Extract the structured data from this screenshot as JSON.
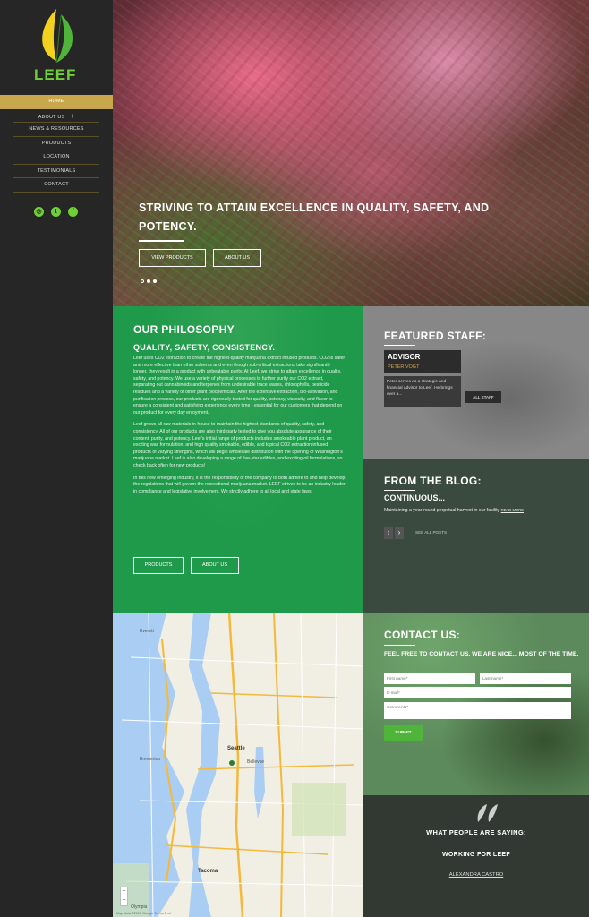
{
  "brand": {
    "name": "LEEF",
    "accent": "#6fcf36",
    "gold": "#c9a84d"
  },
  "nav": {
    "items": [
      {
        "label": "HOME"
      },
      {
        "label": "ABOUT US"
      },
      {
        "label": "NEWS & RESOURCES"
      },
      {
        "label": "PRODUCTS"
      },
      {
        "label": "LOCATION"
      },
      {
        "label": "TESTIMONIALS"
      },
      {
        "label": "CONTACT"
      }
    ],
    "about_expand": "+"
  },
  "social": {
    "instagram": "◎",
    "twitter": "t",
    "facebook": "f"
  },
  "hero": {
    "title": "STRIVING TO ATTAIN EXCELLENCE IN QUALITY, SAFETY, AND POTENCY.",
    "btn_products": "VIEW PRODUCTS",
    "btn_about": "ABOUT US"
  },
  "philosophy": {
    "title": "OUR PHILOSOPHY",
    "subtitle": "QUALITY, SAFETY, CONSISTENCY.",
    "p1": "Leef uses CO2 extraction to create the highest-quality marijuana extract infused products. CO2 is safer and more effective than other solvents and even though sub-critical extractions take significantly longer, they result in a product with unbeatable purity. At Leef, we strive to attain excellence in quality, safety, and potency. We use a variety of physical processes to further purify our CO2 extract, separating out cannabinoids and terpenes from undesirable trace waxes, chlorophylls, pesticide residues and a variety of other plant biochemicals. After the extensive extraction, bio-activation, and purification process, our products are rigorously tested for quality, potency, viscosity, and flavor to ensure a consistent and satisfying experience every time - essential for our customers that depend on our product for every day enjoyment.",
    "p2": "Leef grows all raw materials in-house to maintain the highest standards of quality, safety, and consistency. All of our products are also third-party tested to give you absolute assurance of their content, purity, and potency. Leef's initial range of products includes smokeable plant product, an exciting wax formulation, and high quality smokable, edible, and topical CO2 extraction infused products of varying strengths, which will begin wholesale distribution with the opening of Washington's marijuana market. Leef is also developing a range of five-star edibles, and exciting oil formulations, so check back often for new products!",
    "p3": "In this new emerging industry, it is the responsibility of the company to both adhere to and help develop the regulations that will govern the recreational marijuana market. LEEF strives to be an industry leader in compliance and legislative involvement. We strictly adhere to all local and state laws.",
    "btn_products": "PRODUCTS",
    "btn_about": "ABOUT US"
  },
  "staff": {
    "title": "FEATURED STAFF:",
    "role": "ADVISOR",
    "name": "PETER VOGT",
    "desc": "Peter serves as a strategic and financial advisor to Leef. He brings over a...",
    "btn_all": "ALL STAFF"
  },
  "blog": {
    "title": "FROM THE BLOG:",
    "post_title": "CONTINUOUS...",
    "excerpt": "Maintaining a year-round perpetual harvest in our facility",
    "read_more": "READ MORE",
    "prev": "‹",
    "next": "›",
    "see_all": "SEE ALL POSTS"
  },
  "map": {
    "footer": "Map data ©2015 Google   Terms   1 mi",
    "zoom_in": "+",
    "zoom_out": "−",
    "labels": {
      "seattle": "Seattle",
      "bellevue": "Bellevue",
      "tacoma": "Tacoma",
      "everett": "Everett",
      "bremerton": "Bremerton",
      "olympia": "Olympia"
    }
  },
  "contact": {
    "title": "CONTACT US:",
    "lead": "FEEL FREE TO CONTACT US. WE ARE NICE... MOST OF THE TIME.",
    "first_name": "First name*",
    "last_name": "Last name*",
    "email": "E-mail*",
    "comments": "Comments*",
    "submit": "SUBMIT"
  },
  "testimonials": {
    "title": "WHAT PEOPLE ARE SAYING:",
    "subtitle": "WORKING FOR LEEF",
    "author": "ALEXANDRA CASTRO"
  }
}
